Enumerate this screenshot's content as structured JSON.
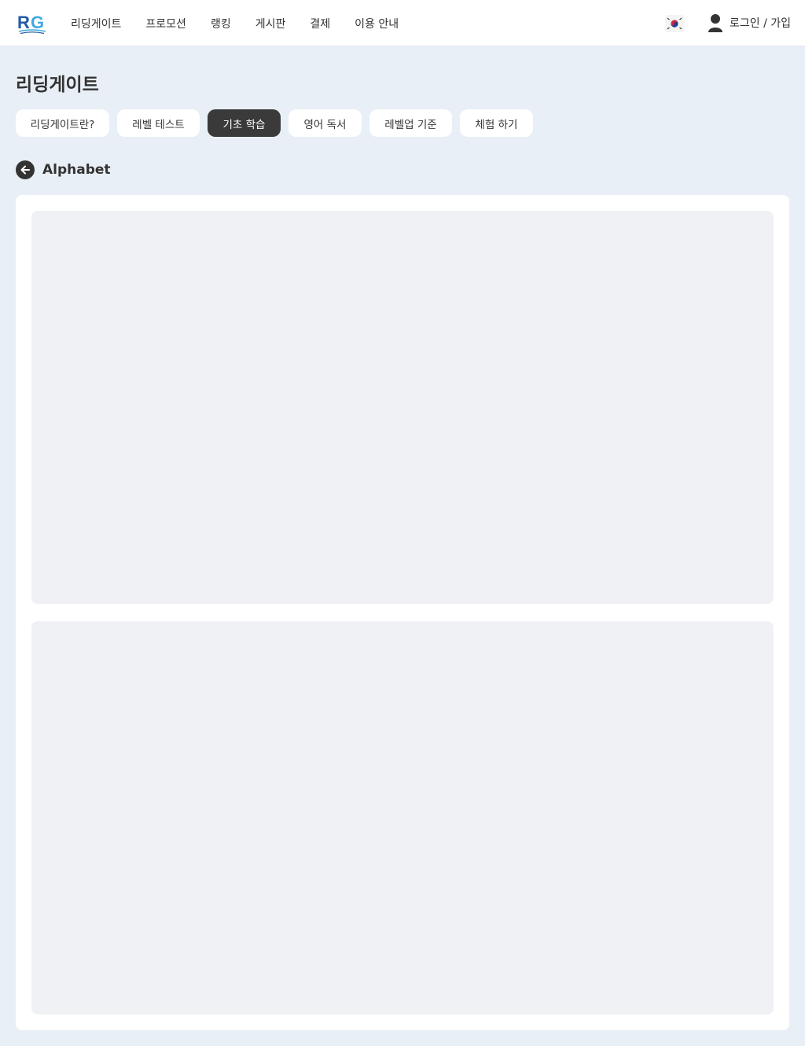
{
  "header": {
    "logo_text": "RG",
    "nav": [
      {
        "label": "리딩게이트"
      },
      {
        "label": "프로모션"
      },
      {
        "label": "랭킹"
      },
      {
        "label": "게시판"
      },
      {
        "label": "결제"
      },
      {
        "label": "이용 안내"
      }
    ],
    "flag_icon": "korea-flag-icon",
    "user_label": "로그인 / 가입"
  },
  "page": {
    "title": "리딩게이트"
  },
  "tabs": [
    {
      "label": "리딩게이트란?",
      "active": false
    },
    {
      "label": "레벨 테스트",
      "active": false
    },
    {
      "label": "기초 학습",
      "active": true
    },
    {
      "label": "영어 독서",
      "active": false
    },
    {
      "label": "레벨업 기준",
      "active": false
    },
    {
      "label": "체험 하기",
      "active": false
    }
  ],
  "section": {
    "back_icon": "arrow-left-icon",
    "title": "Alphabet"
  },
  "colors": {
    "page_bg": "#e8eff6",
    "active_tab": "#3a3a3a",
    "panel_bg": "#eff1f5",
    "logo_blue": "#1f5ba8",
    "logo_light_blue": "#3fa9e0"
  }
}
